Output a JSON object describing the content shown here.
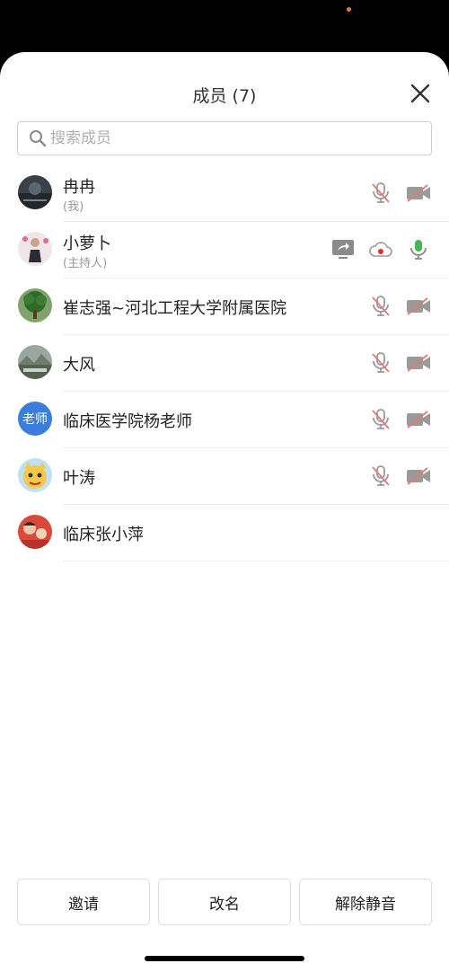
{
  "header": {
    "title": "成员 (7)"
  },
  "search": {
    "placeholder": "搜索成员"
  },
  "members": [
    {
      "name": "冉冉",
      "role": "(我)"
    },
    {
      "name": "小萝卜",
      "role": "(主持人)"
    },
    {
      "name": "崔志强~河北工程大学附属医院"
    },
    {
      "name": "大风"
    },
    {
      "name": "临床医学院杨老师",
      "avatar_text": "老师"
    },
    {
      "name": "叶涛"
    },
    {
      "name": "临床张小萍"
    }
  ],
  "footer": {
    "invite": "邀请",
    "rename": "改名",
    "unmute": "解除静音"
  },
  "colors": {
    "muted_red": "#e07a7a",
    "active_green": "#3fb950",
    "avatar_blue": "#3b7ddd",
    "record_red": "#e0312e"
  },
  "icons": {
    "close": "close-icon",
    "search": "search-icon",
    "mic_muted": "mic-muted-icon",
    "camera_off": "camera-off-icon",
    "mic_on": "mic-icon",
    "screen_share": "screen-share-icon",
    "cloud_record": "cloud-record-icon"
  }
}
